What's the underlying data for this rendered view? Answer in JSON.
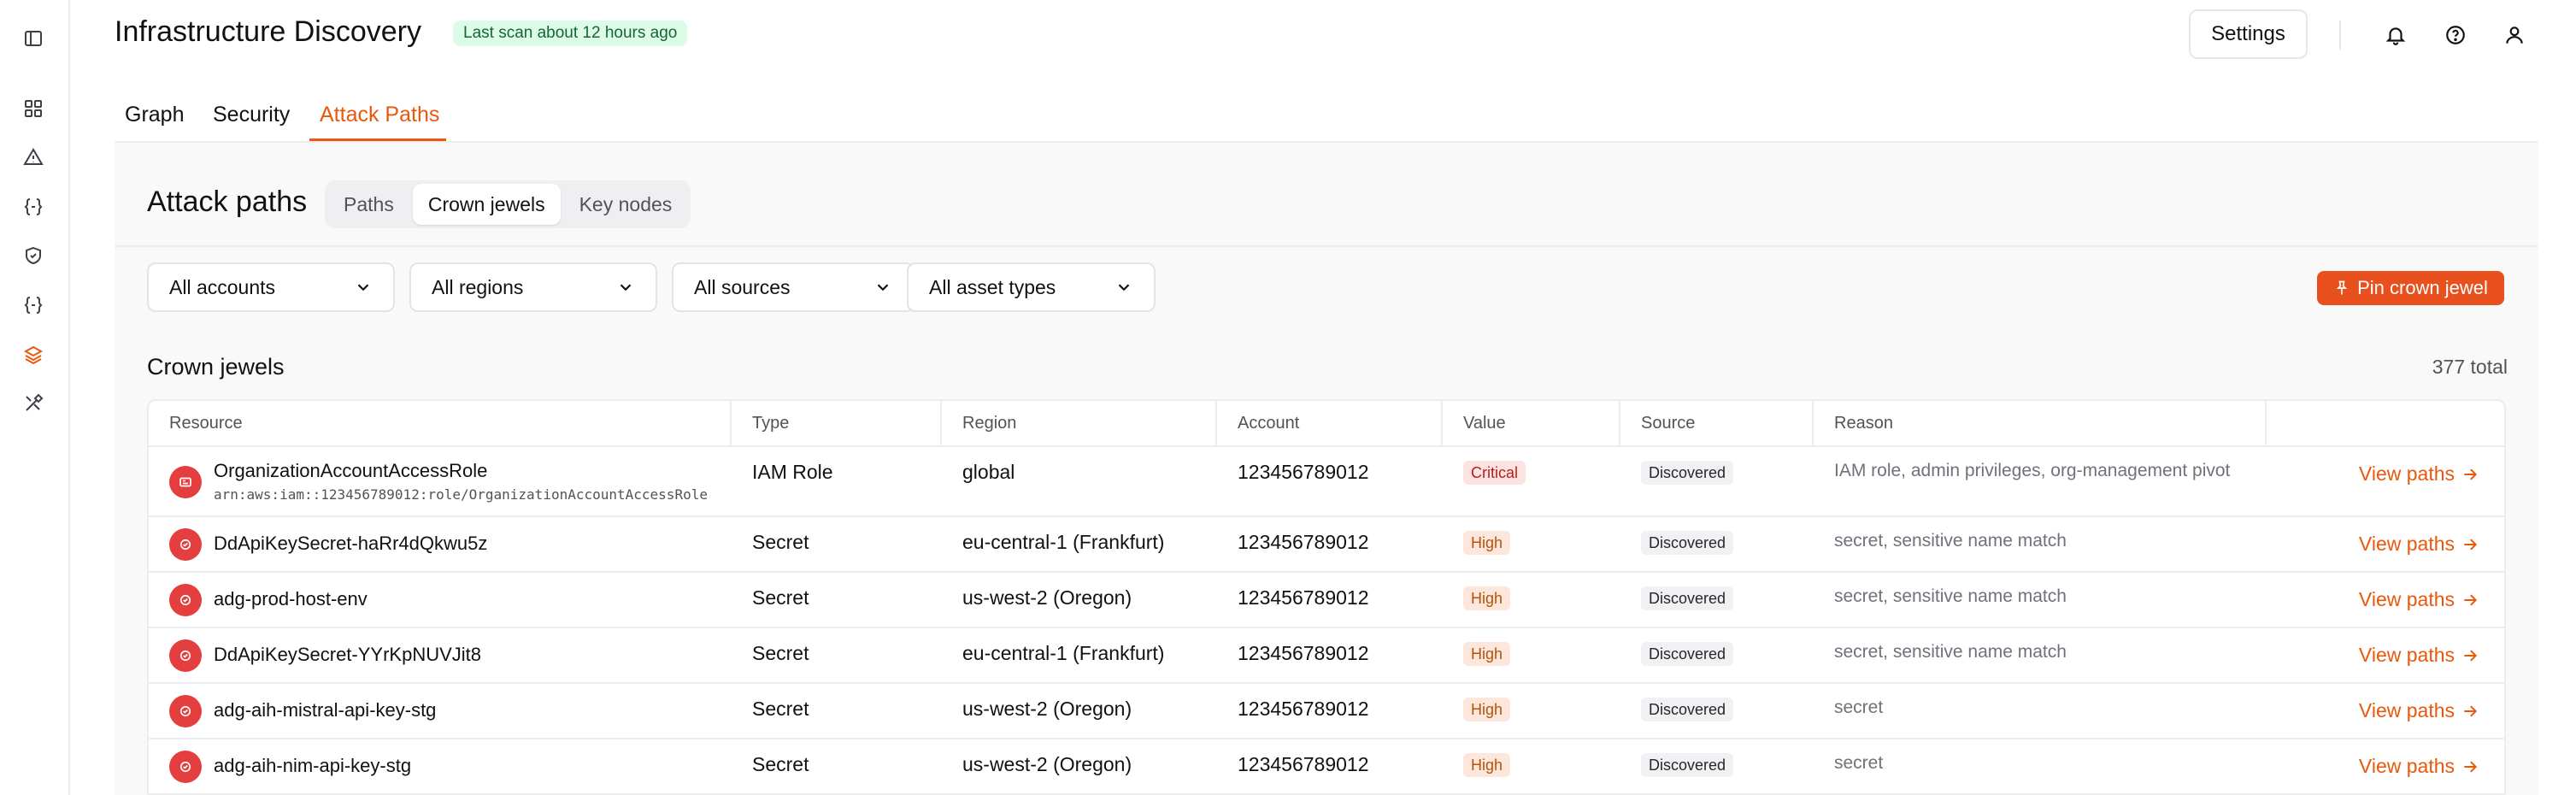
{
  "header": {
    "title": "Infrastructure Discovery",
    "scan_status": "Last scan about 12 hours ago",
    "settings_label": "Settings"
  },
  "tabs": [
    {
      "label": "Graph",
      "active": false
    },
    {
      "label": "Security",
      "active": false
    },
    {
      "label": "Attack Paths",
      "active": true
    }
  ],
  "panel": {
    "title": "Attack paths",
    "segments": [
      {
        "label": "Paths",
        "active": false
      },
      {
        "label": "Crown jewels",
        "active": true
      },
      {
        "label": "Key nodes",
        "active": false
      }
    ],
    "filters": {
      "accounts": "All accounts",
      "regions": "All regions",
      "sources": "All sources",
      "asset_types": "All asset types"
    },
    "pin_label": "Pin crown jewel",
    "section_title": "Crown jewels",
    "total": "377 total"
  },
  "table": {
    "columns": [
      "Resource",
      "Type",
      "Region",
      "Account",
      "Value",
      "Source",
      "Reason",
      ""
    ],
    "rows": [
      {
        "name": "OrganizationAccountAccessRole",
        "arn": "arn:aws:iam::123456789012:role/OrganizationAccountAccessRole",
        "type": "IAM Role",
        "region": "global",
        "account": "123456789012",
        "value": "Critical",
        "source": "Discovered",
        "reason": "IAM role, admin privileges, org-management pivot",
        "action": "View paths"
      },
      {
        "name": "DdApiKeySecret-haRr4dQkwu5z",
        "type": "Secret",
        "region": "eu-central-1 (Frankfurt)",
        "account": "123456789012",
        "value": "High",
        "source": "Discovered",
        "reason": "secret, sensitive name match",
        "action": "View paths"
      },
      {
        "name": "adg-prod-host-env",
        "type": "Secret",
        "region": "us-west-2 (Oregon)",
        "account": "123456789012",
        "value": "High",
        "source": "Discovered",
        "reason": "secret, sensitive name match",
        "action": "View paths"
      },
      {
        "name": "DdApiKeySecret-YYrKpNUVJit8",
        "type": "Secret",
        "region": "eu-central-1 (Frankfurt)",
        "account": "123456789012",
        "value": "High",
        "source": "Discovered",
        "reason": "secret, sensitive name match",
        "action": "View paths"
      },
      {
        "name": "adg-aih-mistral-api-key-stg",
        "type": "Secret",
        "region": "us-west-2 (Oregon)",
        "account": "123456789012",
        "value": "High",
        "source": "Discovered",
        "reason": "secret",
        "action": "View paths"
      },
      {
        "name": "adg-aih-nim-api-key-stg",
        "type": "Secret",
        "region": "us-west-2 (Oregon)",
        "account": "123456789012",
        "value": "High",
        "source": "Discovered",
        "reason": "secret",
        "action": "View paths"
      }
    ]
  },
  "icons": {
    "rail": [
      "sidebar-toggle-icon",
      "dashboard-icon",
      "alert-triangle-icon",
      "braces-icon",
      "shield-icon",
      "braces-icon",
      "layers-icon",
      "tools-icon"
    ],
    "header": [
      "bell-icon",
      "help-circle-icon",
      "user-icon"
    ]
  },
  "colors": {
    "accent": "#ea580c",
    "pin_button": "#e8501e",
    "critical_badge": "#fde2e2",
    "high_badge": "#fde7dc",
    "scan_badge": "#dcfce7"
  }
}
